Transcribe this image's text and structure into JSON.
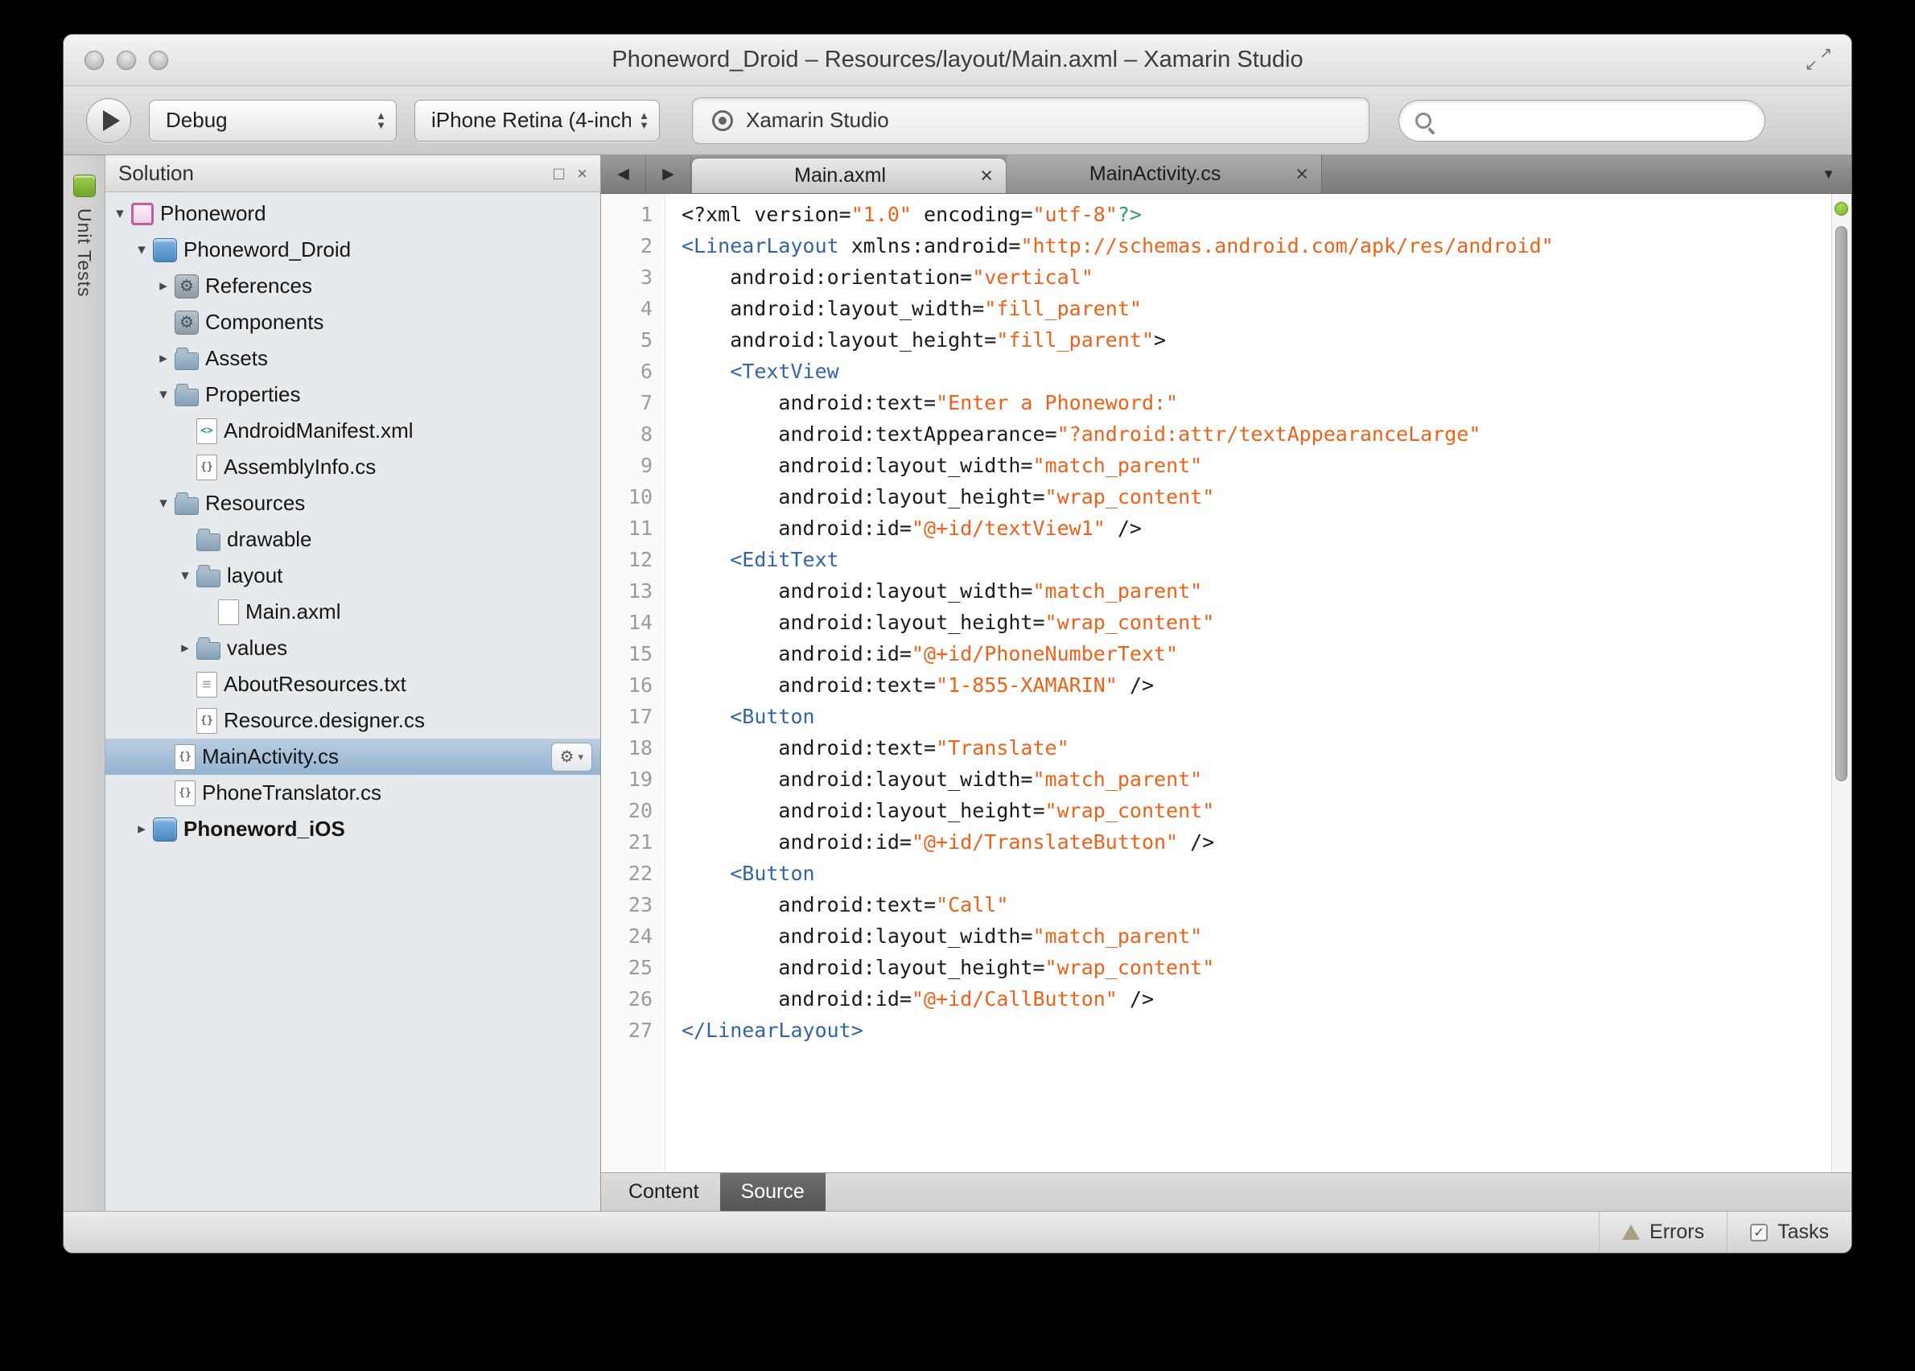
{
  "window": {
    "title": "Phoneword_Droid – Resources/layout/Main.axml – Xamarin Studio"
  },
  "toolbar": {
    "config_label": "Debug",
    "device_label": "iPhone Retina (4-inch",
    "status_label": "Xamarin Studio",
    "search_value": ""
  },
  "icons": {
    "expander_open": "▾",
    "expander_closed": "▸",
    "tab_close": "×",
    "back_arrow": "◀",
    "forward_arrow": "▶",
    "overflow_chevron": "▼",
    "gear": "⚙",
    "gear_caret": "▾",
    "fullscreen_ne": "↗",
    "fullscreen_sw": "↙",
    "pad_dock": "□",
    "pad_close": "×",
    "stepper_up": "▲",
    "stepper_down": "▼",
    "tasks_check": "✓"
  },
  "sidebar": {
    "dock_tab_label": "Unit Tests",
    "solution_pad": {
      "title": "Solution",
      "tree": [
        {
          "label": "Phoneword",
          "depth": 0,
          "expander": "open",
          "icon": "solution"
        },
        {
          "label": "Phoneword_Droid",
          "depth": 1,
          "expander": "open",
          "icon": "project"
        },
        {
          "label": "References",
          "depth": 2,
          "expander": "closed",
          "icon": "references"
        },
        {
          "label": "Components",
          "depth": 2,
          "expander": null,
          "icon": "components"
        },
        {
          "label": "Assets",
          "depth": 2,
          "expander": "closed",
          "icon": "folder"
        },
        {
          "label": "Properties",
          "depth": 2,
          "expander": "open",
          "icon": "folder"
        },
        {
          "label": "AndroidManifest.xml",
          "depth": 3,
          "expander": null,
          "icon": "xml"
        },
        {
          "label": "AssemblyInfo.cs",
          "depth": 3,
          "expander": null,
          "icon": "cs"
        },
        {
          "label": "Resources",
          "depth": 2,
          "expander": "open",
          "icon": "folder"
        },
        {
          "label": "drawable",
          "depth": 3,
          "expander": null,
          "icon": "folder"
        },
        {
          "label": "layout",
          "depth": 3,
          "expander": "open",
          "icon": "folder"
        },
        {
          "label": "Main.axml",
          "depth": 4,
          "expander": null,
          "icon": "file"
        },
        {
          "label": "values",
          "depth": 3,
          "expander": "closed",
          "icon": "folder"
        },
        {
          "label": "AboutResources.txt",
          "depth": 3,
          "expander": null,
          "icon": "txt"
        },
        {
          "label": "Resource.designer.cs",
          "depth": 3,
          "expander": null,
          "icon": "cs"
        },
        {
          "label": "MainActivity.cs",
          "depth": 2,
          "expander": null,
          "icon": "cs",
          "selected": true,
          "gear": true
        },
        {
          "label": "PhoneTranslator.cs",
          "depth": 2,
          "expander": null,
          "icon": "cs"
        },
        {
          "label": "Phoneword_iOS",
          "depth": 1,
          "expander": "closed",
          "icon": "project",
          "bold": true
        }
      ]
    }
  },
  "editor": {
    "tabs": [
      {
        "label": "Main.axml",
        "active": true
      },
      {
        "label": "MainActivity.cs",
        "active": false
      }
    ],
    "bottom_tabs": [
      {
        "label": "Content",
        "active": false
      },
      {
        "label": "Source",
        "active": true
      }
    ],
    "code": {
      "syntax": {
        "p": "#1A1A1A",
        "t": "#3364A4",
        "s": "#ED6118",
        "g": "#2E9E67"
      },
      "lines": [
        [
          [
            "p",
            "<?xml version="
          ],
          [
            "s",
            "\"1.0\""
          ],
          [
            "p",
            " encoding="
          ],
          [
            "s",
            "\"utf-8\""
          ],
          [
            "g",
            "?>"
          ]
        ],
        [
          [
            "t",
            "<LinearLayout"
          ],
          [
            "p",
            " xmlns:android="
          ],
          [
            "s",
            "\"http://schemas.android.com/apk/res/android\""
          ]
        ],
        [
          [
            "p",
            "    android:orientation="
          ],
          [
            "s",
            "\"vertical\""
          ]
        ],
        [
          [
            "p",
            "    android:layout_width="
          ],
          [
            "s",
            "\"fill_parent\""
          ]
        ],
        [
          [
            "p",
            "    android:layout_height="
          ],
          [
            "s",
            "\"fill_parent\""
          ],
          [
            "p",
            ">"
          ]
        ],
        [
          [
            "p",
            "    "
          ],
          [
            "t",
            "<TextView"
          ]
        ],
        [
          [
            "p",
            "        android:text="
          ],
          [
            "s",
            "\"Enter a Phoneword:\""
          ]
        ],
        [
          [
            "p",
            "        android:textAppearance="
          ],
          [
            "s",
            "\"?android:attr/textAppearanceLarge\""
          ]
        ],
        [
          [
            "p",
            "        android:layout_width="
          ],
          [
            "s",
            "\"match_parent\""
          ]
        ],
        [
          [
            "p",
            "        android:layout_height="
          ],
          [
            "s",
            "\"wrap_content\""
          ]
        ],
        [
          [
            "p",
            "        android:id="
          ],
          [
            "s",
            "\"@+id/textView1\""
          ],
          [
            "p",
            " />"
          ]
        ],
        [
          [
            "p",
            "    "
          ],
          [
            "t",
            "<EditText"
          ]
        ],
        [
          [
            "p",
            "        android:layout_width="
          ],
          [
            "s",
            "\"match_parent\""
          ]
        ],
        [
          [
            "p",
            "        android:layout_height="
          ],
          [
            "s",
            "\"wrap_content\""
          ]
        ],
        [
          [
            "p",
            "        android:id="
          ],
          [
            "s",
            "\"@+id/PhoneNumberText\""
          ]
        ],
        [
          [
            "p",
            "        android:text="
          ],
          [
            "s",
            "\"1-855-XAMARIN\""
          ],
          [
            "p",
            " />"
          ]
        ],
        [
          [
            "p",
            "    "
          ],
          [
            "t",
            "<Button"
          ]
        ],
        [
          [
            "p",
            "        android:text="
          ],
          [
            "s",
            "\"Translate\""
          ]
        ],
        [
          [
            "p",
            "        android:layout_width="
          ],
          [
            "s",
            "\"match_parent\""
          ]
        ],
        [
          [
            "p",
            "        android:layout_height="
          ],
          [
            "s",
            "\"wrap_content\""
          ]
        ],
        [
          [
            "p",
            "        android:id="
          ],
          [
            "s",
            "\"@+id/TranslateButton\""
          ],
          [
            "p",
            " />"
          ]
        ],
        [
          [
            "p",
            "    "
          ],
          [
            "t",
            "<Button"
          ]
        ],
        [
          [
            "p",
            "        android:text="
          ],
          [
            "s",
            "\"Call\""
          ]
        ],
        [
          [
            "p",
            "        android:layout_width="
          ],
          [
            "s",
            "\"match_parent\""
          ]
        ],
        [
          [
            "p",
            "        android:layout_height="
          ],
          [
            "s",
            "\"wrap_content\""
          ]
        ],
        [
          [
            "p",
            "        android:id="
          ],
          [
            "s",
            "\"@+id/CallButton\""
          ],
          [
            "p",
            " />"
          ]
        ],
        [
          [
            "t",
            "</LinearLayout>"
          ]
        ]
      ]
    }
  },
  "footer": {
    "errors_label": "Errors",
    "tasks_label": "Tasks"
  }
}
